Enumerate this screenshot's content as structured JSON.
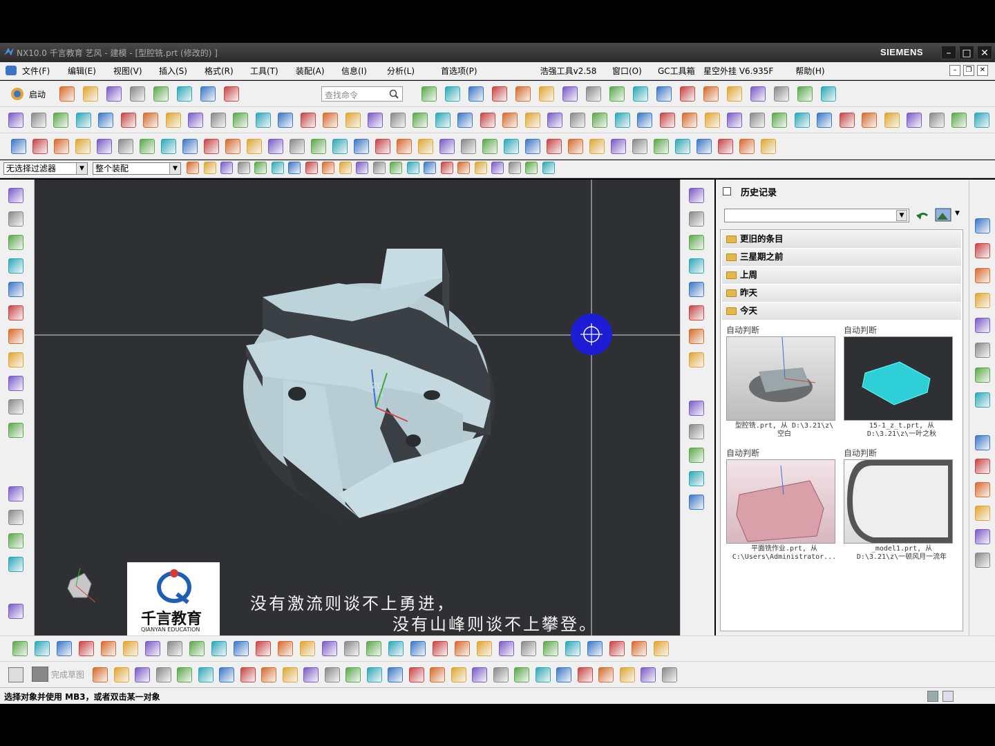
{
  "window": {
    "title": "NX10.0 千言教育 艺风 - 建模 - [型腔铣.prt  (修改的)  ]",
    "brand": "SIEMENS"
  },
  "menu": [
    "文件(F)",
    "编辑(E)",
    "视图(V)",
    "插入(S)",
    "格式(R)",
    "工具(T)",
    "装配(A)",
    "信息(I)",
    "分析(L)",
    "首选项(P)",
    "浩强工具v2.58",
    "窗口(O)",
    "GC工具箱",
    "星空外挂 V6.935F",
    "帮助(H)"
  ],
  "toolbar": {
    "start_label": "启动",
    "search_placeholder": "查找命令"
  },
  "selection": {
    "filter_value": "无选择过滤器",
    "scope_value": "整个装配"
  },
  "viewport": {
    "axis_label": "ZC",
    "subtitle_line1": "没有激流则谈不上勇进，",
    "subtitle_line2": "没有山峰则谈不上攀登。",
    "logo_cn": "千言教育",
    "logo_en": "QIANYAN EDUCATION"
  },
  "history": {
    "title": "历史记录",
    "groups": [
      "更旧的条目",
      "三星期之前",
      "上周",
      "昨天",
      "今天"
    ],
    "items": [
      {
        "label": "自动判断",
        "caption1": "型腔铣.prt, 从 D:\\3.21\\z\\",
        "caption2": "空白"
      },
      {
        "label": "自动判断",
        "caption1": "15-1_z_t.prt, 从",
        "caption2": "D:\\3.21\\z\\一叶之秋"
      },
      {
        "label": "自动判断",
        "caption1": "平面铣作业.prt, 从",
        "caption2": "C:\\Users\\Administrator..."
      },
      {
        "label": "自动判断",
        "caption1": "_model1.prt, 从",
        "caption2": "D:\\3.21\\z\\一顿风月一流年"
      }
    ]
  },
  "bottom_toolbar": {
    "sketch_finish_label": "完成草图"
  },
  "status": {
    "message": "选择对象并使用 MB3，或者双击某一对象"
  }
}
